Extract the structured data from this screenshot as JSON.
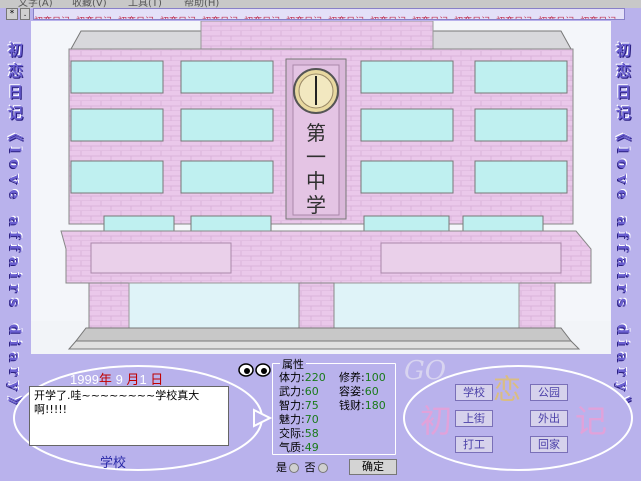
{
  "menu": [
    "文字(A)",
    "收藏(V)",
    "工具(T)",
    "帮助(H)"
  ],
  "window": {
    "sys_button": "*",
    "dot_button": ".",
    "title_repeat": [
      "初恋日记",
      "初恋日记",
      "初恋日记",
      "初恋日记",
      "初恋日记",
      "初恋日记",
      "初恋日记",
      "初恋日记",
      "初恋日记",
      "初恋日记",
      "初恋日记",
      "初恋日记",
      "初恋日记",
      "初恋日记"
    ]
  },
  "side": {
    "left_text": "初恋日记《love affairs diary》",
    "right_text": "初恋日记《love affairs diary》"
  },
  "scene": {
    "building_name": [
      "第",
      "一",
      "中",
      "学"
    ]
  },
  "date": {
    "year": "1999",
    "year_unit": "年",
    "month": "9",
    "month_unit": "月",
    "day": "1",
    "day_unit": "日"
  },
  "message": "开学了.哇~~~~~~~~学校真大啊!!!!!",
  "location": "学校",
  "attributes": {
    "legend": "属性",
    "left": [
      {
        "label": "体力:",
        "value": "220"
      },
      {
        "label": "武力:",
        "value": "60"
      },
      {
        "label": "智力:",
        "value": "75"
      },
      {
        "label": "魅力:",
        "value": "70"
      },
      {
        "label": "交际:",
        "value": "58"
      },
      {
        "label": "气质:",
        "value": "49"
      }
    ],
    "right": [
      {
        "label": "修养:",
        "value": "100"
      },
      {
        "label": "容姿:",
        "value": "60"
      },
      {
        "label": "钱财:",
        "value": "180"
      }
    ]
  },
  "confirm": {
    "yes": "是",
    "no": "否",
    "ok": "确定"
  },
  "logo": {
    "go": "GO",
    "chars": [
      "初",
      "恋",
      "记"
    ]
  },
  "actions": [
    "学校",
    "公园",
    "上街",
    "外出",
    "打工",
    "回家"
  ],
  "colors": {
    "background": "#b9b2ec",
    "building_pink": "#e8c8e8",
    "window_cyan": "#bff0f0",
    "attr_value": "#1a7a1a"
  }
}
